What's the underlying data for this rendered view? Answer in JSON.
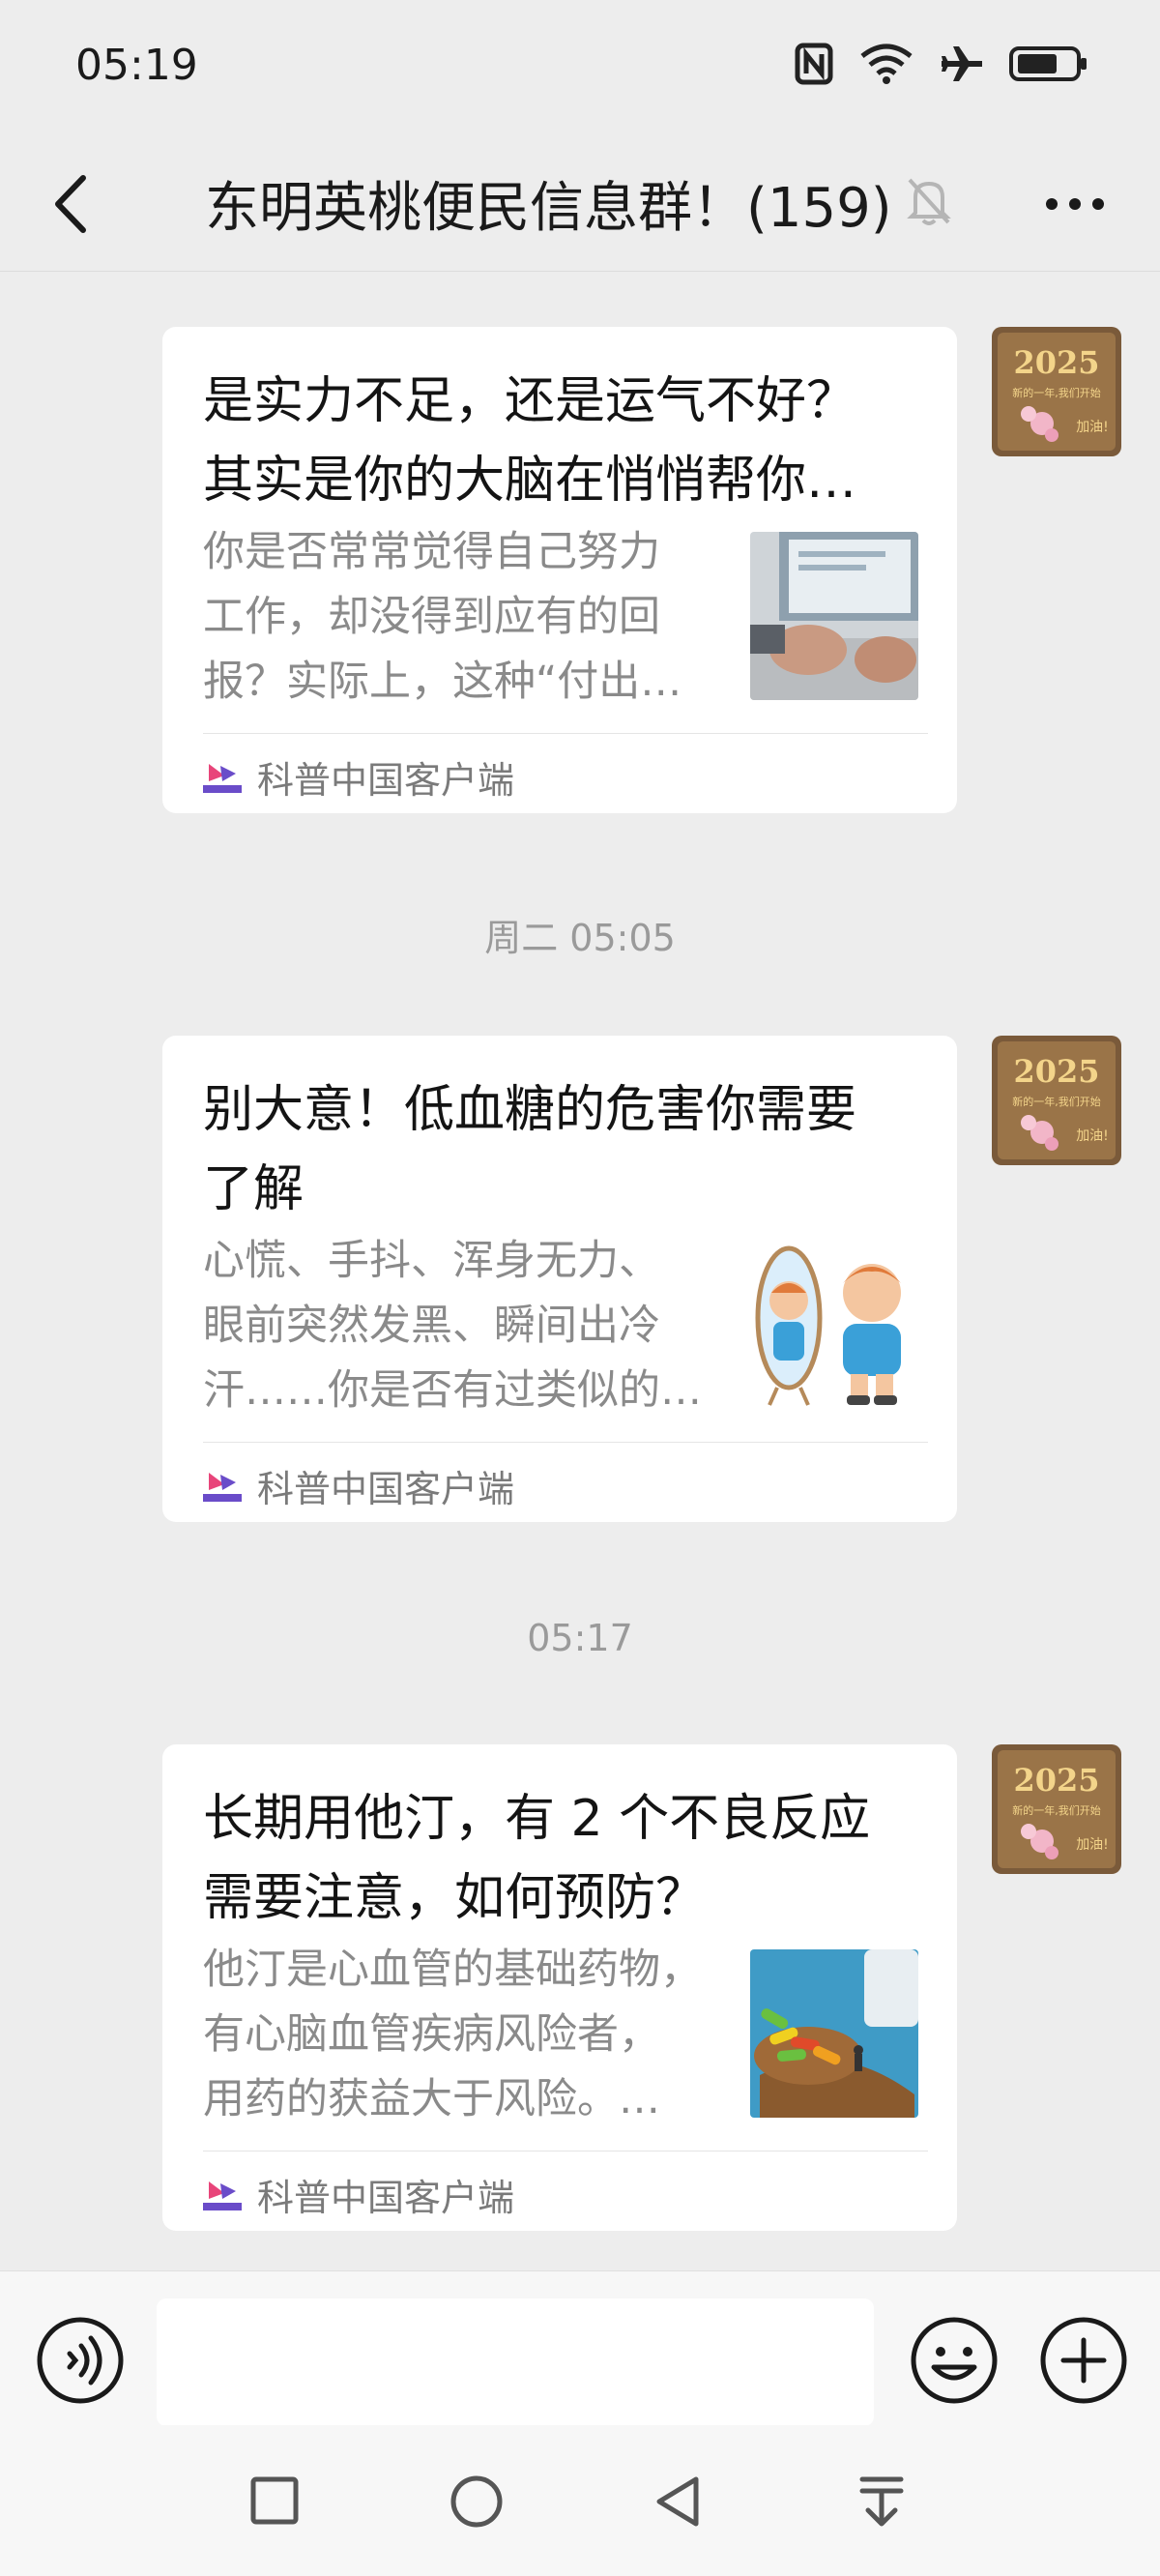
{
  "status_bar": {
    "time": "05:19",
    "icons": [
      "nfc-icon",
      "wifi-icon",
      "airplane-icon",
      "battery-icon"
    ]
  },
  "header": {
    "title": "东明英桃便民信息群！(159)",
    "icons": [
      "back-icon",
      "mute-bell-icon",
      "more-icon"
    ]
  },
  "messages": [
    {
      "title_lines": [
        "是实力不足，还是运气不好？",
        "其实是你的大脑在悄悄帮你…"
      ],
      "desc_lines": [
        "你是否常常觉得自己努力",
        "工作，却没得到应有的回",
        "报？实际上，这种“付出…"
      ],
      "source": "科普中国客户端",
      "thumb": "typing-hands"
    },
    {
      "timestamp": "周二 05:05",
      "title_lines": [
        "别大意！低血糖的危害你需要",
        "了解"
      ],
      "desc_lines": [
        "心慌、手抖、浑身无力、",
        "眼前突然发黑、瞬间出冷",
        "汗……你是否有过类似的…"
      ],
      "source": "科普中国客户端",
      "thumb": "boy-mirror"
    },
    {
      "timestamp": "05:17",
      "title_lines": [
        "长期用他汀，有 2 个不良反应",
        "需要注意，如何预防？"
      ],
      "desc_lines": [
        "他汀是心血管的基础药物，",
        "有心脑血管疾病风险者，",
        "用药的获益大于风险。…"
      ],
      "source": "科普中国客户端",
      "thumb": "pills-spoon"
    }
  ],
  "avatar": {
    "year": "2025",
    "line1": "新的一年,我们开始",
    "line2": "加油!"
  },
  "input_bar": {
    "value": "",
    "icons": [
      "voice-icon",
      "emoji-icon",
      "plus-icon"
    ]
  },
  "nav_bar": {
    "icons": [
      "recents-icon",
      "home-icon",
      "back-triangle-icon",
      "notification-pull-icon"
    ]
  },
  "colors": {
    "background": "#ededed",
    "card": "#ffffff",
    "source_logo_pink": "#e8457a",
    "source_logo_purple": "#6a4cc9"
  }
}
